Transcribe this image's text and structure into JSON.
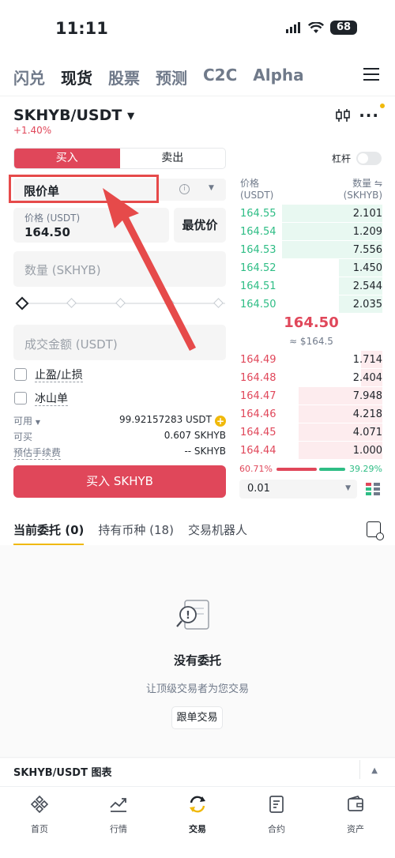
{
  "status_bar": {
    "time": "11:11",
    "battery": "68"
  },
  "top_tabs": [
    "闪兑",
    "现货",
    "股票",
    "预测",
    "C2C",
    "Alpha"
  ],
  "top_tabs_active_index": 1,
  "pair": {
    "symbol": "SKHYB/USDT",
    "change": "+1.40%"
  },
  "trade_form": {
    "buy_label": "买入",
    "sell_label": "卖出",
    "leverage_label": "杠杆",
    "order_type": "限价单",
    "price_label": "价格 (USDT)",
    "price_value": "164.50",
    "best_price_label": "最优价",
    "quantity_placeholder": "数量 (SKHYB)",
    "amount_placeholder": "成交金额 (USDT)",
    "tp_sl_label": "止盈/止损",
    "iceberg_label": "冰山单",
    "available_label": "可用",
    "available_value": "99.92157283 USDT",
    "can_buy_label": "可买",
    "can_buy_value": "0.607 SKHYB",
    "est_fee_label": "预估手续费",
    "est_fee_value": "-- SKHYB",
    "submit_label": "买入 SKHYB"
  },
  "order_book": {
    "price_header": "价格",
    "price_unit": "(USDT)",
    "qty_header": "数量",
    "qty_unit": "(SKHYB)",
    "asks": [
      {
        "price": "164.55",
        "qty": "2.101",
        "depth": 0.7
      },
      {
        "price": "164.54",
        "qty": "1.209",
        "depth": 0.7
      },
      {
        "price": "164.53",
        "qty": "7.556",
        "depth": 0.7
      },
      {
        "price": "164.52",
        "qty": "1.450",
        "depth": 0.3
      },
      {
        "price": "164.51",
        "qty": "2.544",
        "depth": 0.3
      },
      {
        "price": "164.50",
        "qty": "2.035",
        "depth": 0.3
      }
    ],
    "mid_price": "164.50",
    "mid_usd": "≈ $164.5",
    "bids": [
      {
        "price": "164.49",
        "qty": "1.714",
        "depth": 0.15
      },
      {
        "price": "164.48",
        "qty": "2.404",
        "depth": 0.15
      },
      {
        "price": "164.47",
        "qty": "7.948",
        "depth": 0.58
      },
      {
        "price": "164.46",
        "qty": "4.218",
        "depth": 0.58
      },
      {
        "price": "164.45",
        "qty": "4.071",
        "depth": 0.58
      },
      {
        "price": "164.44",
        "qty": "1.000",
        "depth": 0.58
      }
    ],
    "buy_ratio": "60.71%",
    "sell_ratio": "39.29%",
    "buy_ratio_value": 0.6071,
    "precision": "0.01"
  },
  "lower_tabs": [
    "当前委托 (0)",
    "持有币种 (18)",
    "交易机器人"
  ],
  "empty_state": {
    "title": "没有委托",
    "subtitle": "让顶级交易者为您交易",
    "button": "跟单交易"
  },
  "chart_section": {
    "label": "SKHYB/USDT 图表"
  },
  "bottom_nav": [
    "首页",
    "行情",
    "交易",
    "合约",
    "资产"
  ],
  "colors": {
    "buy": "#e0475a",
    "sell": "#2ebd85",
    "accent": "#f0b90b",
    "annotation": "#e64a4a"
  }
}
